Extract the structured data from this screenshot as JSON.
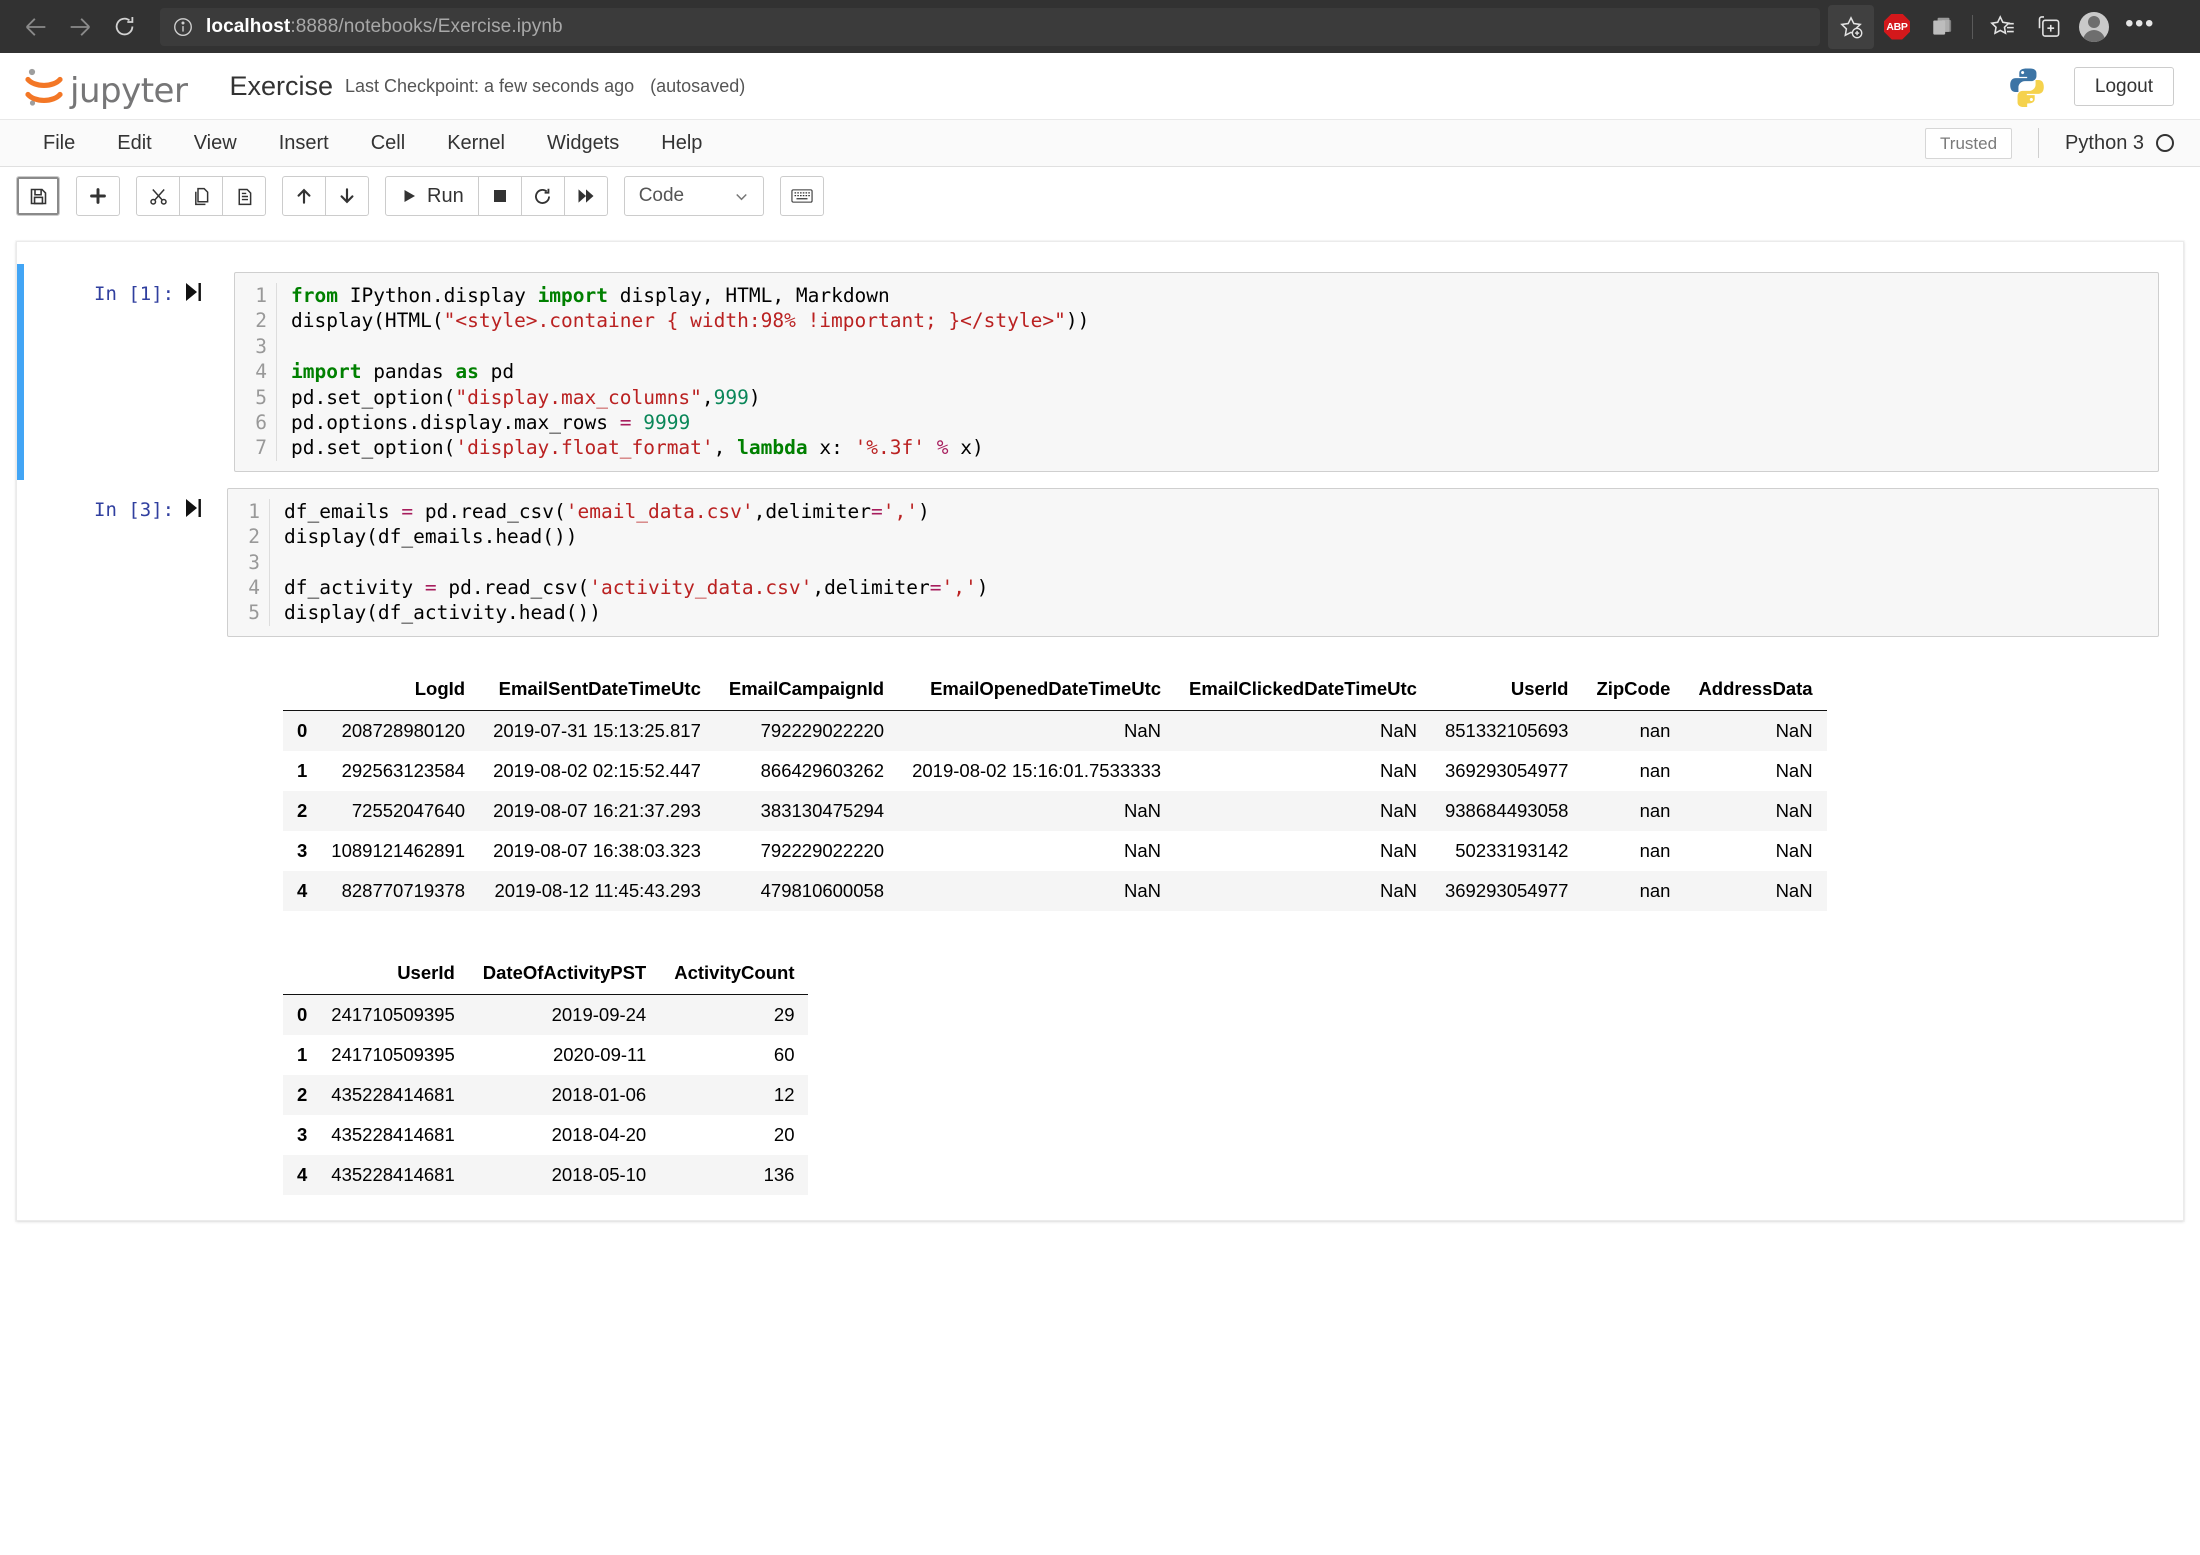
{
  "browser": {
    "url_host": "localhost",
    "url_path": ":8888/notebooks/Exercise.ipynb",
    "back_icon": "back-arrow-icon",
    "forward_icon": "forward-arrow-icon",
    "reload_icon": "reload-icon",
    "info_icon": "info-icon",
    "favorite_icon": "add-favorite-star-icon",
    "abp_label": "ABP",
    "collections_icon": "collections-icon",
    "favorites_icon": "favorites-list-icon",
    "add_tab_icon": "add-collection-icon",
    "profile_icon": "profile-avatar-icon",
    "more_icon": "more-options-icon"
  },
  "jupyter": {
    "brand": "jupyter",
    "logo_icon": "jupyter-logo-icon",
    "notebook_name": "Exercise",
    "checkpoint": "Last Checkpoint: a few seconds ago",
    "autosaved": "(autosaved)",
    "python_logo_icon": "python-logo-icon",
    "logout_label": "Logout"
  },
  "menubar": {
    "items": [
      {
        "label": "File"
      },
      {
        "label": "Edit"
      },
      {
        "label": "View"
      },
      {
        "label": "Insert"
      },
      {
        "label": "Cell"
      },
      {
        "label": "Kernel"
      },
      {
        "label": "Widgets"
      },
      {
        "label": "Help"
      }
    ],
    "trusted_label": "Trusted",
    "kernel_label": "Python 3",
    "kernel_status_icon": "kernel-idle-circle-icon"
  },
  "toolbar": {
    "save_icon": "save-floppy-icon",
    "add_icon": "add-cell-plus-icon",
    "cut_icon": "scissors-cut-icon",
    "copy_icon": "copy-icon",
    "paste_icon": "paste-icon",
    "move_up_icon": "arrow-up-icon",
    "move_down_icon": "arrow-down-icon",
    "run_label": "Run",
    "run_icon": "play-triangle-icon",
    "stop_icon": "stop-square-icon",
    "restart_icon": "restart-circular-arrow-icon",
    "restart_run_all_icon": "fast-forward-icon",
    "cell_type_value": "Code",
    "cell_type_caret_icon": "chevron-down-icon",
    "command_palette_icon": "keyboard-icon"
  },
  "cells": [
    {
      "prompt": "In [1]:",
      "run_icon": "run-this-cell-icon",
      "selected": true,
      "lines": [
        {
          "n": "1",
          "html": "<span class=\"k\">from</span> IPython.display <span class=\"k\">import</span> display, HTML, Markdown"
        },
        {
          "n": "2",
          "html": "display(HTML(<span class=\"str\">\"&lt;style&gt;.container { width:98% !important; }&lt;/style&gt;\"</span>))"
        },
        {
          "n": "3",
          "html": ""
        },
        {
          "n": "4",
          "html": "<span class=\"k\">import</span> pandas <span class=\"k\">as</span> pd"
        },
        {
          "n": "5",
          "html": "pd.set_option(<span class=\"str\">\"display.max_columns\"</span>,<span class=\"num\">999</span>)"
        },
        {
          "n": "6",
          "html": "pd.options.display.max_rows <span class=\"op\">=</span> <span class=\"num\">9999</span>"
        },
        {
          "n": "7",
          "html": "pd.set_option(<span class=\"str\">'display.float_format'</span>, <span class=\"k\">lambda</span> x: <span class=\"str\">'%.3f'</span> <span class=\"op\">%</span> x)"
        }
      ]
    },
    {
      "prompt": "In [3]:",
      "run_icon": "run-this-cell-icon",
      "selected": false,
      "lines": [
        {
          "n": "1",
          "html": "df_emails <span class=\"op\">=</span> pd.read_csv(<span class=\"str\">'email_data.csv'</span>,delimiter<span class=\"op\">=</span><span class=\"str\">','</span>)"
        },
        {
          "n": "2",
          "html": "display(df_emails.head())"
        },
        {
          "n": "3",
          "html": ""
        },
        {
          "n": "4",
          "html": "df_activity <span class=\"op\">=</span> pd.read_csv(<span class=\"str\">'activity_data.csv'</span>,delimiter<span class=\"op\">=</span><span class=\"str\">','</span>)"
        },
        {
          "n": "5",
          "html": "display(df_activity.head())"
        }
      ]
    }
  ],
  "tables": [
    {
      "name": "df_emails_head",
      "columns": [
        "LogId",
        "EmailSentDateTimeUtc",
        "EmailCampaignId",
        "EmailOpenedDateTimeUtc",
        "EmailClickedDateTimeUtc",
        "UserId",
        "ZipCode",
        "AddressData"
      ],
      "index": [
        "0",
        "1",
        "2",
        "3",
        "4"
      ],
      "rows": [
        [
          "208728980120",
          "2019-07-31 15:13:25.817",
          "792229022220",
          "NaN",
          "NaN",
          "851332105693",
          "nan",
          "NaN"
        ],
        [
          "292563123584",
          "2019-08-02 02:15:52.447",
          "866429603262",
          "2019-08-02 15:16:01.7533333",
          "NaN",
          "369293054977",
          "nan",
          "NaN"
        ],
        [
          "72552047640",
          "2019-08-07 16:21:37.293",
          "383130475294",
          "NaN",
          "NaN",
          "938684493058",
          "nan",
          "NaN"
        ],
        [
          "1089121462891",
          "2019-08-07 16:38:03.323",
          "792229022220",
          "NaN",
          "NaN",
          "50233193142",
          "nan",
          "NaN"
        ],
        [
          "828770719378",
          "2019-08-12 11:45:43.293",
          "479810600058",
          "NaN",
          "NaN",
          "369293054977",
          "nan",
          "NaN"
        ]
      ]
    },
    {
      "name": "df_activity_head",
      "columns": [
        "UserId",
        "DateOfActivityPST",
        "ActivityCount"
      ],
      "index": [
        "0",
        "1",
        "2",
        "3",
        "4"
      ],
      "rows": [
        [
          "241710509395",
          "2019-09-24",
          "29"
        ],
        [
          "241710509395",
          "2020-09-11",
          "60"
        ],
        [
          "435228414681",
          "2018-01-06",
          "12"
        ],
        [
          "435228414681",
          "2018-04-20",
          "20"
        ],
        [
          "435228414681",
          "2018-05-10",
          "136"
        ]
      ]
    }
  ],
  "colors": {
    "browser_chrome": "#323232",
    "selected_cell_bar": "#42a5f5",
    "prompt_text": "#303f9f",
    "jupyter_orange": "#f37726",
    "abp_red": "#d4181b"
  }
}
